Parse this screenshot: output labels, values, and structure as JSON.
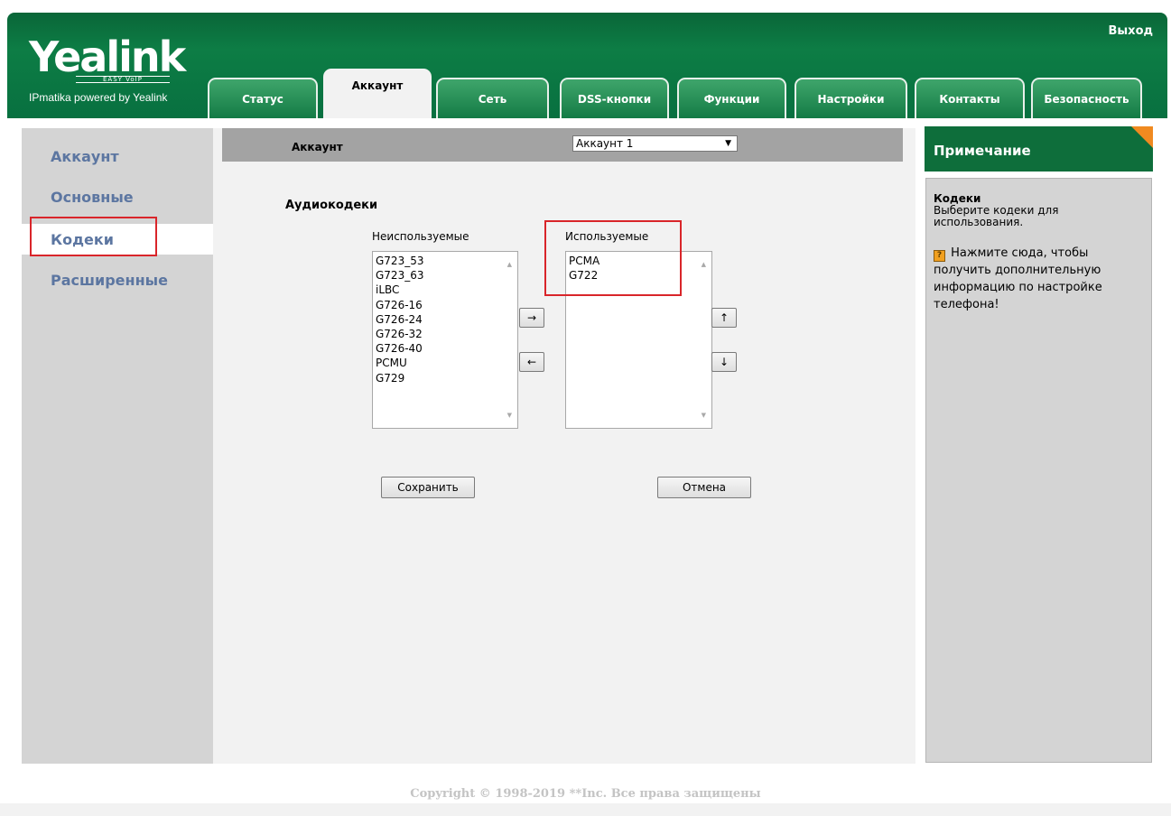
{
  "header": {
    "logo": "Yealink",
    "logo_tagline": "EASY VoIP",
    "powered_by": "IPmatika powered by Yealink",
    "logout": "Выход"
  },
  "tabs": [
    {
      "label": "Статус"
    },
    {
      "label": "Аккаунт",
      "active": true
    },
    {
      "label": "Сеть"
    },
    {
      "label": "DSS-кнопки"
    },
    {
      "label": "Функции"
    },
    {
      "label": "Настройки"
    },
    {
      "label": "Контакты"
    },
    {
      "label": "Безопасность"
    }
  ],
  "sidebar": {
    "items": [
      {
        "label": "Аккаунт"
      },
      {
        "label": "Основные"
      },
      {
        "label": "Кодеки",
        "active": true
      },
      {
        "label": "Расширенные"
      }
    ]
  },
  "main": {
    "bar_label": "Аккаунт",
    "account_select": "Аккаунт 1",
    "section_title": "Аудиокодеки",
    "unused_title": "Неиспользуемые",
    "unused_codecs": [
      "G723_53",
      "G723_63",
      "iLBC",
      "G726-16",
      "G726-24",
      "G726-32",
      "G726-40",
      "PCMU",
      "G729"
    ],
    "used_title": "Используемые",
    "used_codecs": [
      "PCMA",
      "G722"
    ],
    "move_right": "→",
    "move_left": "←",
    "move_up": "↑",
    "move_down": "↓",
    "save": "Сохранить",
    "cancel": "Отмена"
  },
  "note": {
    "header": "Примечание",
    "title": "Кодеки",
    "text": "Выберите кодеки для использования.",
    "hint_icon": "?",
    "hint": "Нажмите сюда, чтобы получить дополнительную информацию по настройке телефона!"
  },
  "footer": "Copyright © 1998-2019 **Inc. Все права защищены",
  "colors": {
    "header_green": "#0d7d45",
    "sidebar_link": "#5c76a1",
    "highlight_red": "#d9252a",
    "note_corner": "#f08a20"
  }
}
